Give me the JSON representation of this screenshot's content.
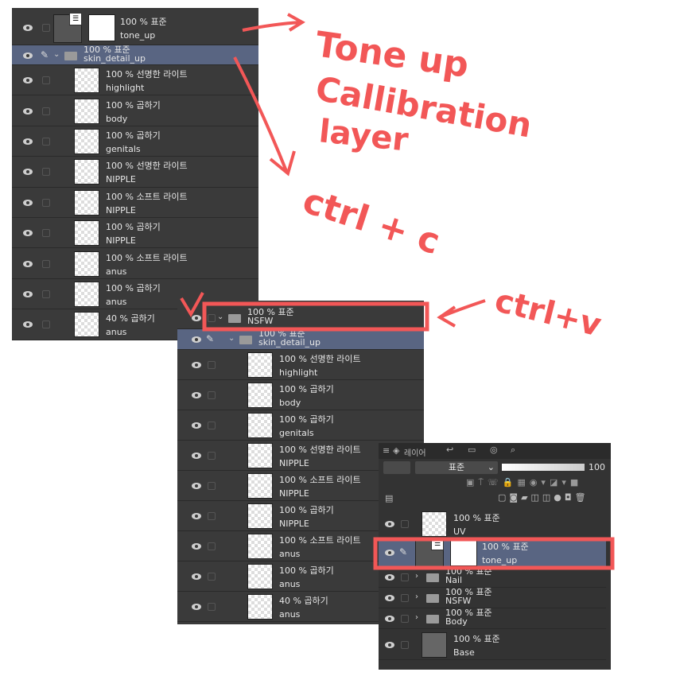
{
  "colors": {
    "annotation": "#f25757",
    "panel": "#3a3a3a",
    "selected": "#596582"
  },
  "panel_a": {
    "layers": [
      {
        "type": "mask",
        "opacity_mode": "100 % 표준",
        "name": "tone_up"
      },
      {
        "type": "folder",
        "opacity_mode": "100 % 표준",
        "name": "skin_detail_up",
        "selected": true,
        "expanded": true
      },
      {
        "type": "child",
        "opacity_mode": "100 % 선명한 라이트",
        "name": "highlight"
      },
      {
        "type": "child",
        "opacity_mode": "100 % 곱하기",
        "name": "body"
      },
      {
        "type": "child",
        "opacity_mode": "100 % 곱하기",
        "name": "genitals"
      },
      {
        "type": "child",
        "opacity_mode": "100 % 선명한 라이트",
        "name": "NIPPLE"
      },
      {
        "type": "child",
        "opacity_mode": "100 % 소프트 라이트",
        "name": "NIPPLE"
      },
      {
        "type": "child",
        "opacity_mode": "100 % 곱하기",
        "name": "NIPPLE"
      },
      {
        "type": "child",
        "opacity_mode": "100 % 소프트 라이트",
        "name": "anus"
      },
      {
        "type": "child",
        "opacity_mode": "100 % 곱하기",
        "name": "anus"
      },
      {
        "type": "child",
        "opacity_mode": "40 % 곱하기",
        "name": "anus"
      }
    ]
  },
  "panel_b": {
    "layers": [
      {
        "type": "folder",
        "opacity_mode": "100 % 표준",
        "name": "NSFW",
        "expanded": true
      },
      {
        "type": "subfolder",
        "opacity_mode": "100 % 표준",
        "name": "skin_detail_up",
        "selected": true,
        "expanded": true
      },
      {
        "type": "child2",
        "opacity_mode": "100 % 선명한 라이트",
        "name": "highlight"
      },
      {
        "type": "child2",
        "opacity_mode": "100 % 곱하기",
        "name": "body"
      },
      {
        "type": "child2",
        "opacity_mode": "100 % 곱하기",
        "name": "genitals"
      },
      {
        "type": "child2",
        "opacity_mode": "100 % 선명한 라이트",
        "name": "NIPPLE"
      },
      {
        "type": "child2",
        "opacity_mode": "100 % 소프트 라이트",
        "name": "NIPPLE"
      },
      {
        "type": "child2",
        "opacity_mode": "100 % 곱하기",
        "name": "NIPPLE"
      },
      {
        "type": "child2",
        "opacity_mode": "100 % 소프트 라이트",
        "name": "anus"
      },
      {
        "type": "child2",
        "opacity_mode": "100 % 곱하기",
        "name": "anus"
      },
      {
        "type": "child2",
        "opacity_mode": "40 % 곱하기",
        "name": "anus"
      }
    ]
  },
  "panel_c": {
    "tab_label": "레이어",
    "blend_mode": "표준",
    "opacity": "100",
    "layers": [
      {
        "type": "plain",
        "opacity_mode": "100 % 표준",
        "name": "UV",
        "hidden": true
      },
      {
        "type": "mask",
        "opacity_mode": "100 % 표준",
        "name": "tone_up",
        "selected": true
      },
      {
        "type": "cfolder",
        "opacity_mode": "100 % 표준",
        "name": "Nail"
      },
      {
        "type": "cfolder",
        "opacity_mode": "100 % 표준",
        "name": "NSFW"
      },
      {
        "type": "cfolder",
        "opacity_mode": "100 % 표준",
        "name": "Body"
      },
      {
        "type": "base",
        "opacity_mode": "100 % 표준",
        "name": "Base"
      }
    ]
  },
  "annotations": {
    "tone_line1": "Tone up",
    "tone_line2": "Callibration",
    "tone_line3": "layer",
    "copy": "ctrl + c",
    "paste": "ctrl+v"
  }
}
